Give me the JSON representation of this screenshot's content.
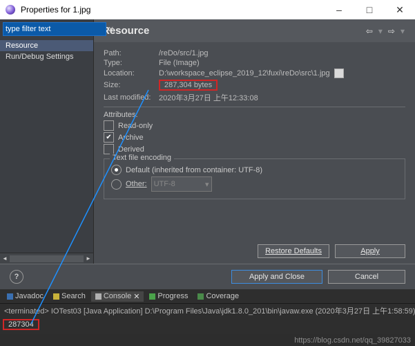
{
  "window": {
    "title": "Properties for 1.jpg"
  },
  "sidebar": {
    "filter_placeholder": "type filter text",
    "filter_value": "type filter text",
    "items": [
      {
        "label": "Resource",
        "selected": true
      },
      {
        "label": "Run/Debug Settings",
        "selected": false
      }
    ]
  },
  "panel": {
    "heading": "Resource",
    "rows": {
      "path_label": "Path:",
      "path_value": "/reDo/src/1.jpg",
      "type_label": "Type:",
      "type_value": "File  (Image)",
      "location_label": "Location:",
      "location_value": "D:\\workspace_eclipse_2019_12\\fuxi\\reDo\\src\\1.jpg",
      "size_label": "Size:",
      "size_value": "287,304  bytes",
      "modified_label": "Last modified:",
      "modified_value": "2020年3月27日 上午12:33:08"
    },
    "attributes": {
      "title": "Attributes:",
      "readonly": "Read-only",
      "archive": "Archive",
      "derived": "Derived"
    },
    "encoding": {
      "group_title": "Text file encoding",
      "default_label": "Default (inherited from container: UTF-8)",
      "other_label": "Other:",
      "other_value": "UTF-8"
    },
    "buttons": {
      "restore": "Restore Defaults",
      "apply": "Apply",
      "apply_close": "Apply and Close",
      "cancel": "Cancel"
    }
  },
  "bottom": {
    "tabs": {
      "javadoc": "Javadoc",
      "search": "Search",
      "console": "Console",
      "progress": "Progress",
      "coverage": "Coverage"
    },
    "terminated": "<terminated> IOTest03 [Java Application] D:\\Program Files\\Java\\jdk1.8.0_201\\bin\\javaw.exe (2020年3月27日 上午1:58:59)",
    "output": "287304"
  },
  "watermark": "https://blog.csdn.net/qq_39827033"
}
